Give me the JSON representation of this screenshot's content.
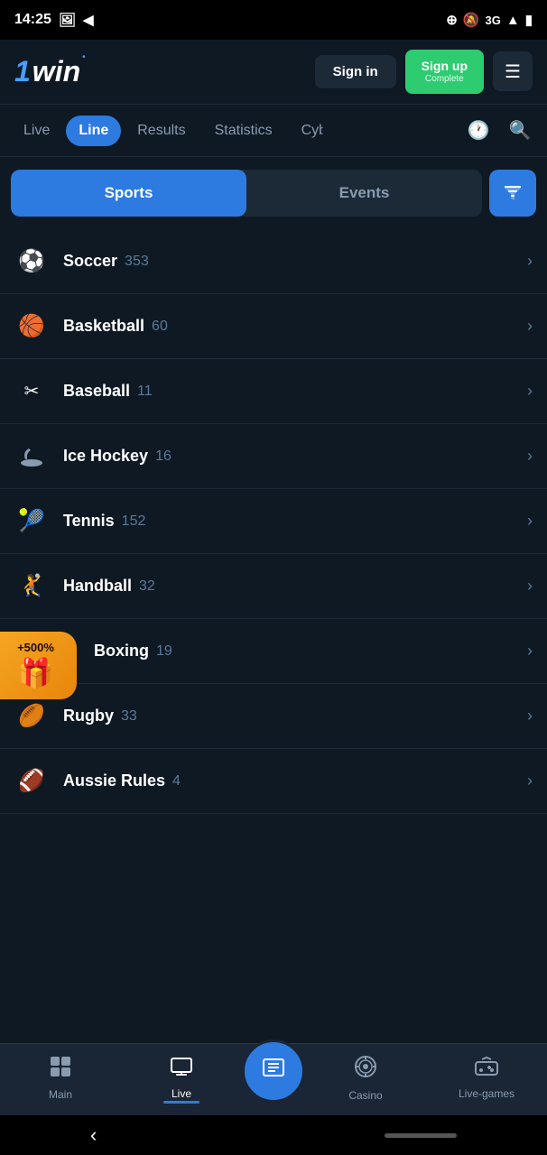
{
  "statusBar": {
    "time": "14:25",
    "icons": [
      "gallery-icon",
      "location-icon",
      "clock-icon",
      "bell-mute-icon",
      "network-3g-icon",
      "signal-icon",
      "battery-icon"
    ]
  },
  "header": {
    "logo": "1win",
    "signinLabel": "Sign in",
    "signupLabel": "Sign up",
    "signupSub": "Complete",
    "menuLabel": "☰"
  },
  "navTabs": {
    "tabs": [
      {
        "id": "live",
        "label": "Live",
        "active": false
      },
      {
        "id": "line",
        "label": "Line",
        "active": true
      },
      {
        "id": "results",
        "label": "Results",
        "active": false
      },
      {
        "id": "statistics",
        "label": "Statistics",
        "active": false
      },
      {
        "id": "cyber",
        "label": "Cyb",
        "active": false
      }
    ],
    "historyIcon": "🕐",
    "searchIcon": "🔍"
  },
  "toggleBar": {
    "sportsLabel": "Sports",
    "eventsLabel": "Events",
    "activeTab": "sports"
  },
  "sports": [
    {
      "id": "soccer",
      "name": "Soccer",
      "count": 353,
      "icon": "⚽"
    },
    {
      "id": "basketball",
      "name": "Basketball",
      "count": 60,
      "icon": "🏀"
    },
    {
      "id": "baseball",
      "name": "Baseball",
      "count": 11,
      "icon": "⚾"
    },
    {
      "id": "icehockey",
      "name": "Ice Hockey",
      "count": 16,
      "icon": "🏒"
    },
    {
      "id": "tennis",
      "name": "Tennis",
      "count": 152,
      "icon": "🎾"
    },
    {
      "id": "handball",
      "name": "Handball",
      "count": 32,
      "icon": "🤾"
    },
    {
      "id": "boxing",
      "name": "Boxing",
      "count": 19,
      "icon": "🥊"
    },
    {
      "id": "rugby",
      "name": "Rugby",
      "count": 33,
      "icon": "🏉"
    },
    {
      "id": "aussierules",
      "name": "Aussie Rules",
      "count": 4,
      "icon": "🏈"
    }
  ],
  "promoBanner": {
    "percent": "+500%",
    "icon": "🎁"
  },
  "bottomNav": {
    "items": [
      {
        "id": "main",
        "label": "Main",
        "icon": "📋",
        "active": false
      },
      {
        "id": "live",
        "label": "Live",
        "icon": "📺",
        "active": true
      },
      {
        "id": "bets",
        "label": "",
        "icon": "🎫",
        "active": false,
        "center": true
      },
      {
        "id": "casino",
        "label": "Casino",
        "icon": "🎰",
        "active": false
      },
      {
        "id": "livegames",
        "label": "Live-games",
        "icon": "🎮",
        "active": false
      }
    ]
  }
}
